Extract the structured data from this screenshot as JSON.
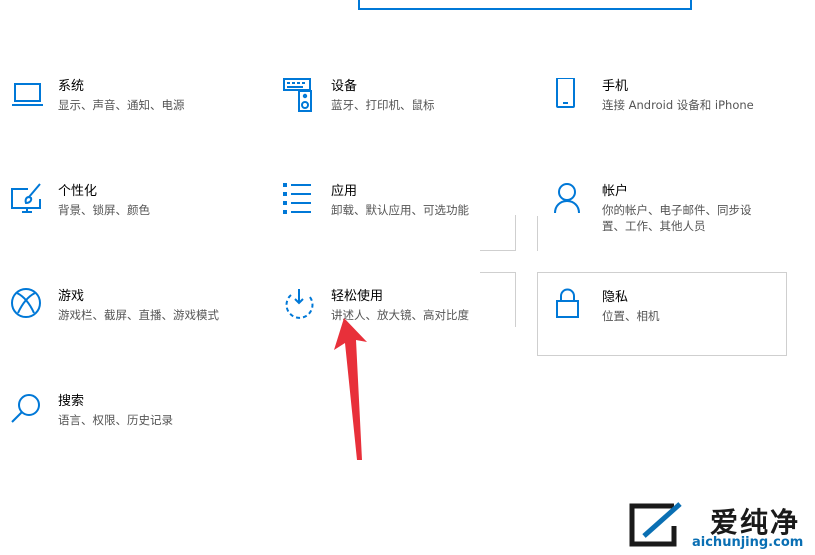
{
  "settings": {
    "items": [
      {
        "id": "system",
        "title": "系统",
        "desc": "显示、声音、通知、电源",
        "icon": "laptop-icon"
      },
      {
        "id": "devices",
        "title": "设备",
        "desc": "蓝牙、打印机、鼠标",
        "icon": "keyboard-speaker-icon"
      },
      {
        "id": "phone",
        "title": "手机",
        "desc": "连接 Android 设备和 iPhone",
        "icon": "phone-icon"
      },
      {
        "id": "personalization",
        "title": "个性化",
        "desc": "背景、锁屏、颜色",
        "icon": "paint-brush-icon"
      },
      {
        "id": "apps",
        "title": "应用",
        "desc": "卸载、默认应用、可选功能",
        "icon": "apps-list-icon"
      },
      {
        "id": "accounts",
        "title": "帐户",
        "desc": "你的帐户、电子邮件、同步设\n置、工作、其他人员",
        "icon": "person-icon"
      },
      {
        "id": "gaming",
        "title": "游戏",
        "desc": "游戏栏、截屏、直播、游戏模式",
        "icon": "xbox-icon"
      },
      {
        "id": "ease-of-access",
        "title": "轻松使用",
        "desc": "讲述人、放大镜、高对比度",
        "icon": "ease-of-access-icon"
      },
      {
        "id": "privacy",
        "title": "隐私",
        "desc": "位置、相机",
        "icon": "lock-icon"
      },
      {
        "id": "search",
        "title": "搜索",
        "desc": "语言、权限、历史记录",
        "icon": "search-icon"
      }
    ]
  },
  "colors": {
    "accent": "#0078d7",
    "arrow": "#e8303a",
    "tile_border": "#cfcfcf"
  },
  "watermark": {
    "cn": "爱纯净",
    "url": "aichunjing.com"
  }
}
